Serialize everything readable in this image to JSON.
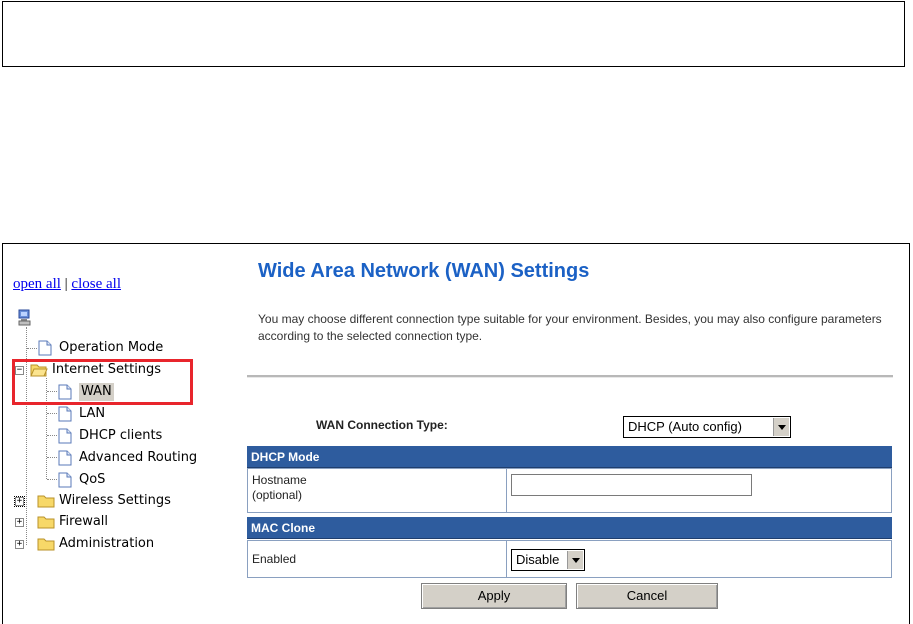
{
  "nav": {
    "open_all": "open all",
    "separator": "|",
    "close_all": "close all"
  },
  "tree": {
    "operation_mode": "Operation Mode",
    "internet_settings": "Internet Settings",
    "wan": "WAN",
    "lan": "LAN",
    "dhcp_clients": "DHCP clients",
    "advanced_routing": "Advanced Routing",
    "qos": "QoS",
    "wireless_settings": "Wireless Settings",
    "firewall": "Firewall",
    "administration": "Administration"
  },
  "main": {
    "title": "Wide Area Network (WAN) Settings",
    "intro": "You may choose different connection type suitable for your environment. Besides, you may also configure parameters according to the selected connection type.",
    "conn_type_label": "WAN Connection Type:",
    "conn_type_value": "DHCP (Auto config)",
    "dhcp_section": "DHCP Mode",
    "hostname_label_1": "Hostname",
    "hostname_label_2": "(optional)",
    "hostname_value": "",
    "mac_section": "MAC Clone",
    "enabled_label": "Enabled",
    "enabled_value": "Disable",
    "apply": "Apply",
    "cancel": "Cancel"
  },
  "colors": {
    "title": "#1b61c5",
    "section_header": "#2e5c9e",
    "highlight": "#e8252c"
  }
}
